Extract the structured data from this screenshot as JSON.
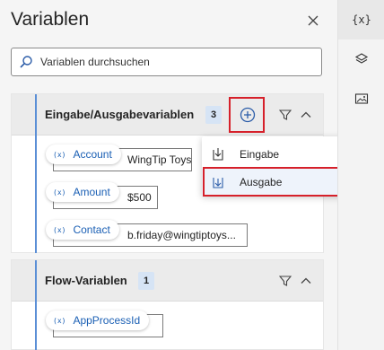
{
  "panel": {
    "title": "Variablen",
    "close_icon": "close-icon"
  },
  "search": {
    "placeholder": "Variablen durchsuchen",
    "icon": "search-icon"
  },
  "rail": {
    "items": [
      {
        "icon": "variables-icon",
        "glyph": "{x}",
        "active": true
      },
      {
        "icon": "layers-icon",
        "active": false
      },
      {
        "icon": "image-icon",
        "active": false
      }
    ]
  },
  "io_section": {
    "title": "Eingabe/Ausgabevariablen",
    "count": "3",
    "variables": [
      {
        "name": "Account",
        "value": "WingTip Toys",
        "type_glyph": "(x)"
      },
      {
        "name": "Amount",
        "value": "$500",
        "type_glyph": "(x)"
      },
      {
        "name": "Contact",
        "value": "b.friday@wingtiptoys...",
        "type_glyph": "(x)"
      }
    ]
  },
  "add_menu": {
    "items": [
      {
        "label": "Eingabe",
        "icon": "input-arrow-icon"
      },
      {
        "label": "Ausgabe",
        "icon": "output-arrow-icon"
      }
    ]
  },
  "flow_section": {
    "title": "Flow-Variablen",
    "count": "1",
    "variables": [
      {
        "name": "AppProcessId",
        "value": "",
        "type_glyph": "(x)"
      }
    ]
  },
  "colors": {
    "accent": "#5b8fd6",
    "link": "#1a5fb4",
    "highlight": "#d6202a"
  }
}
